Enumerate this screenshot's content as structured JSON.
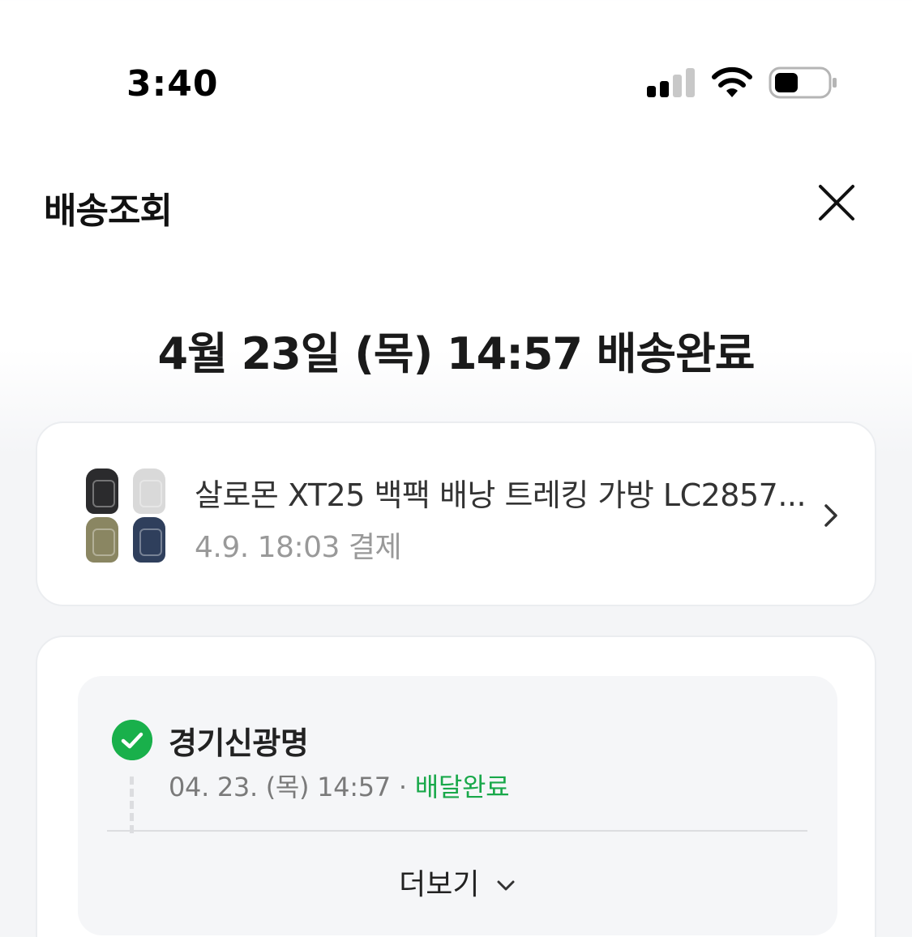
{
  "status_bar": {
    "time": "3:40",
    "signal_icon": "cellular-signal-icon",
    "wifi_icon": "wifi-icon",
    "battery_icon": "battery-icon"
  },
  "header": {
    "title": "배송조회",
    "close_icon": "close-icon"
  },
  "delivery": {
    "headline": "4월 23일 (목) 14:57 배송완료"
  },
  "product": {
    "name": "살로몬 XT25 백팩 배낭 트레킹 가방 LC2857...",
    "paid_at": "4.9. 18:03 결제",
    "thumbnail_colors": [
      "#2b2b2d",
      "#d9d9d9",
      "#8a8662",
      "#2f3f5c"
    ],
    "chevron_icon": "chevron-right-icon"
  },
  "tracking": {
    "events": [
      {
        "location": "경기신광명",
        "datetime": "04. 23. (목) 14:57",
        "separator": "·",
        "status": "배달완료",
        "status_color": "#19a84a",
        "icon": "check-circle-icon"
      }
    ],
    "more_label": "더보기",
    "more_icon": "chevron-down-icon"
  }
}
